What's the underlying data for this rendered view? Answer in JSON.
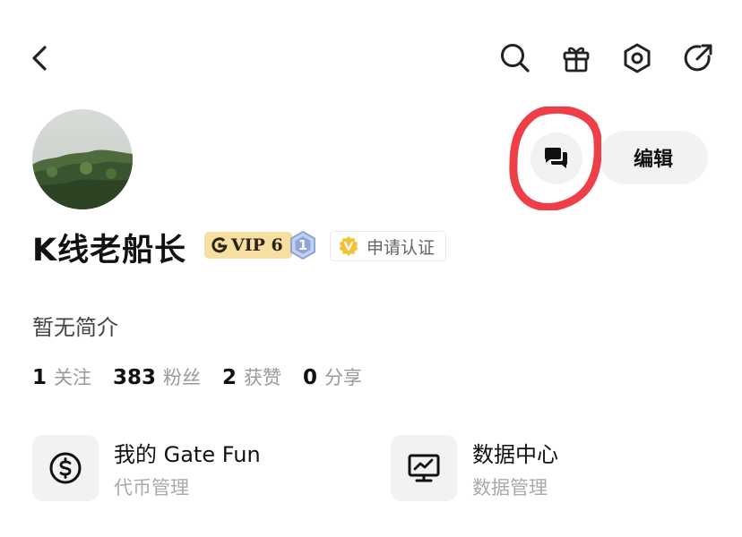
{
  "header": {
    "back_icon": "chevron-left-icon",
    "actions": [
      "search-icon",
      "gift-icon",
      "settings-icon",
      "share-icon"
    ]
  },
  "profile": {
    "name": "K线老船长",
    "vip_badge": "VIP 6",
    "level": "1",
    "verify_label": "申请认证",
    "edit_label": "编辑",
    "bio": "暂无简介"
  },
  "stats": [
    {
      "value": "1",
      "label": "关注"
    },
    {
      "value": "383",
      "label": "粉丝"
    },
    {
      "value": "2",
      "label": "获赞"
    },
    {
      "value": "0",
      "label": "分享"
    }
  ],
  "cards": [
    {
      "title": "我的 Gate Fun",
      "subtitle": "代币管理",
      "icon": "dollar-circle-icon"
    },
    {
      "title": "数据中心",
      "subtitle": "数据管理",
      "icon": "monitor-chart-icon"
    }
  ],
  "colors": {
    "vip_gold": "#f7dfa1",
    "verify_gold": "#f2c233",
    "level_blue": "#8ea5d6",
    "annotation_red": "#ee3e48",
    "button_gray": "#f1f2f4"
  }
}
